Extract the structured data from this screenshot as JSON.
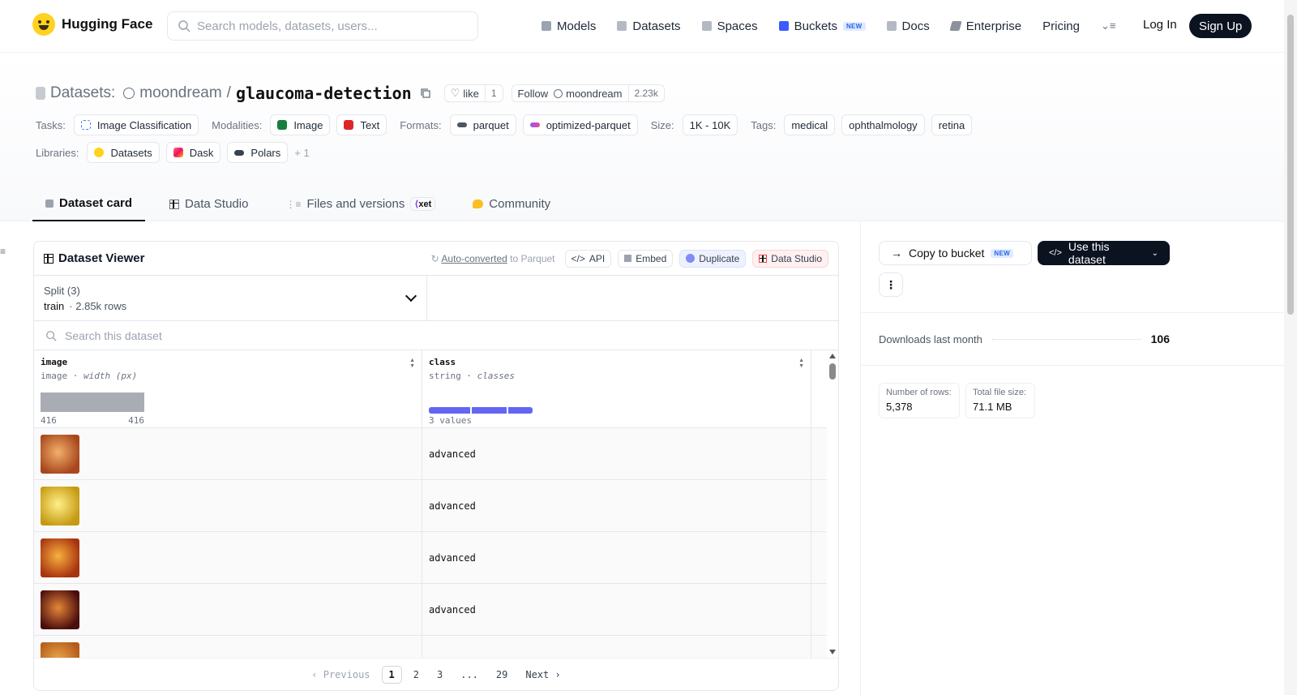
{
  "nav": {
    "brand": "Hugging Face",
    "search_placeholder": "Search models, datasets, users...",
    "links": [
      {
        "label": "Models",
        "icon": "cube-icon",
        "color": "#8b95a5"
      },
      {
        "label": "Datasets",
        "icon": "database-icon",
        "color": "#9aa3b0"
      },
      {
        "label": "Spaces",
        "icon": "grid-icon",
        "color": "#9aa3b0"
      },
      {
        "label": "Buckets",
        "icon": "bucket-icon",
        "color": "#3b5bff",
        "badge": "NEW"
      },
      {
        "label": "Docs",
        "icon": "book-icon",
        "color": "#9aa3b0"
      },
      {
        "label": "Enterprise",
        "icon": "enterprise-icon",
        "color": "#6b7280"
      },
      {
        "label": "Pricing"
      }
    ],
    "login": "Log In",
    "signup": "Sign Up"
  },
  "repo": {
    "kind": "Datasets:",
    "owner": "moondream",
    "sep": "/",
    "name": "glaucoma-detection",
    "like_label": "like",
    "like_count": "1",
    "follow_label": "Follow",
    "follow_owner": "moondream",
    "follow_count": "2.23k"
  },
  "tags": {
    "tasks_label": "Tasks:",
    "tasks": [
      "Image Classification"
    ],
    "modalities_label": "Modalities:",
    "modalities": [
      "Image",
      "Text"
    ],
    "formats_label": "Formats:",
    "formats": [
      "parquet",
      "optimized-parquet"
    ],
    "size_label": "Size:",
    "size": "1K - 10K",
    "tags_label": "Tags:",
    "tags_list": [
      "medical",
      "ophthalmology",
      "retina"
    ],
    "libraries_label": "Libraries:",
    "libraries": [
      "Datasets",
      "Dask",
      "Polars"
    ],
    "libraries_more": "+ 1"
  },
  "tabs": [
    {
      "label": "Dataset card",
      "active": true
    },
    {
      "label": "Data Studio"
    },
    {
      "label": "Files and versions",
      "badge": "xet"
    },
    {
      "label": "Community"
    }
  ],
  "viewer": {
    "title": "Dataset Viewer",
    "auto_converted": "Auto-converted",
    "to_parquet": "to Parquet",
    "api": "API",
    "embed": "Embed",
    "duplicate": "Duplicate",
    "data_studio": "Data Studio",
    "split_label": "Split (3)",
    "split_value": "train",
    "split_rows": "2.85k rows",
    "search_placeholder": "Search this dataset",
    "columns": [
      {
        "name": "image",
        "dtype": "image",
        "stat": "width (px)",
        "min": "416",
        "max": "416"
      },
      {
        "name": "class",
        "dtype": "string",
        "stat": "classes",
        "summary": "3 values"
      }
    ],
    "rows": [
      {
        "class": "advanced",
        "c1": "#a8461c",
        "c2": "#f2b06a"
      },
      {
        "class": "advanced",
        "c1": "#c69a12",
        "c2": "#fff08a"
      },
      {
        "class": "advanced",
        "c1": "#a8330f",
        "c2": "#f8b040"
      },
      {
        "class": "advanced",
        "c1": "#4a0c0c",
        "c2": "#e6863a"
      },
      {
        "class": "",
        "c1": "#b55a1a",
        "c2": "#e8a84a"
      }
    ],
    "pager": {
      "prev": "Previous",
      "pages": [
        "1",
        "2",
        "3",
        "...",
        "29"
      ],
      "next": "Next"
    }
  },
  "sidebar": {
    "copy_to_bucket": "Copy to bucket",
    "copy_badge": "NEW",
    "use_dataset": "Use this dataset",
    "downloads_label": "Downloads last month",
    "downloads_value": "106",
    "rows_label": "Number of rows:",
    "rows_value": "5,378",
    "size_label": "Total file size:",
    "size_value": "71.1 MB"
  }
}
